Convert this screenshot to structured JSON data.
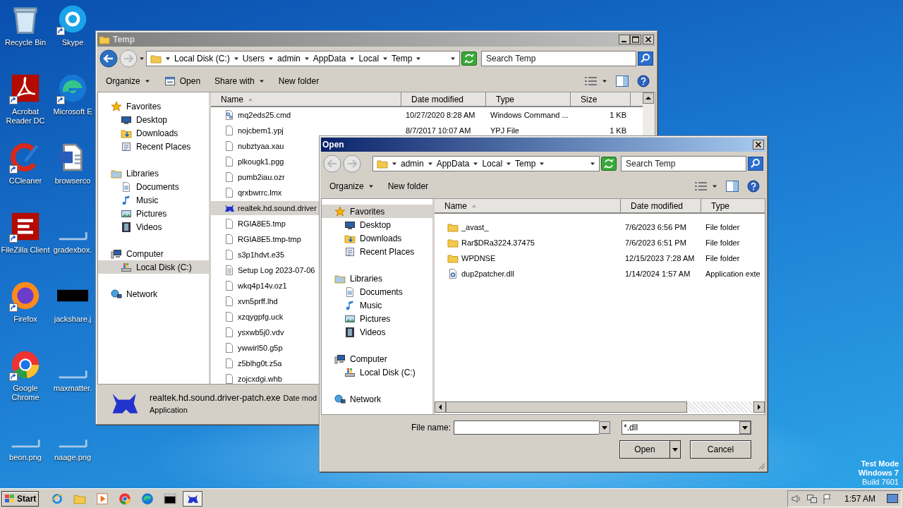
{
  "desktop": {
    "icons": [
      {
        "label": "Recycle Bin",
        "kind": "recycle",
        "shortcut": false
      },
      {
        "label": "Acrobat Reader DC",
        "kind": "acrobat",
        "shortcut": true
      },
      {
        "label": "CCleaner",
        "kind": "ccleaner",
        "shortcut": true
      },
      {
        "label": "FileZilla Client",
        "kind": "filezilla",
        "shortcut": true
      },
      {
        "label": "Firefox",
        "kind": "firefox",
        "shortcut": true
      },
      {
        "label": "Google Chrome",
        "kind": "chrome",
        "shortcut": true
      },
      {
        "label": "beon.png",
        "kind": "blank",
        "shortcut": false
      },
      {
        "label": "Skype",
        "kind": "skype",
        "shortcut": true
      },
      {
        "label": "Microsoft E",
        "kind": "edge",
        "shortcut": true
      },
      {
        "label": "browserco",
        "kind": "word",
        "shortcut": false
      },
      {
        "label": "gradexbox.",
        "kind": "blank",
        "shortcut": false
      },
      {
        "label": "jackshare.j",
        "kind": "dark",
        "shortcut": false
      },
      {
        "label": "maxmatter.",
        "kind": "blank",
        "shortcut": false
      },
      {
        "label": "naage.png",
        "kind": "blank",
        "shortcut": false
      }
    ]
  },
  "explorer": {
    "title": "Temp",
    "breadcrumb": [
      "Local Disk (C:)",
      "Users",
      "admin",
      "AppData",
      "Local",
      "Temp"
    ],
    "search_placeholder": "Search Temp",
    "toolbar": [
      {
        "label": "Organize",
        "kind": "menu"
      },
      {
        "label": "Open",
        "kind": "icon"
      },
      {
        "label": "Share with",
        "kind": "menu"
      },
      {
        "label": "New folder",
        "kind": "plain"
      }
    ],
    "nav": [
      {
        "label": "Favorites",
        "kind": "star",
        "selected": false,
        "children": [
          {
            "label": "Desktop",
            "kind": "desktop",
            "selected": false
          },
          {
            "label": "Downloads",
            "kind": "downloads",
            "selected": false
          },
          {
            "label": "Recent Places",
            "kind": "recent",
            "selected": false
          }
        ]
      },
      {
        "label": "Libraries",
        "kind": "libraries",
        "selected": false,
        "children": [
          {
            "label": "Documents",
            "kind": "documents",
            "selected": false
          },
          {
            "label": "Music",
            "kind": "music",
            "selected": false
          },
          {
            "label": "Pictures",
            "kind": "pictures",
            "selected": false
          },
          {
            "label": "Videos",
            "kind": "videos",
            "selected": false
          }
        ]
      },
      {
        "label": "Computer",
        "kind": "computer",
        "selected": false,
        "children": [
          {
            "label": "Local Disk (C:)",
            "kind": "disk",
            "selected": true
          }
        ]
      },
      {
        "label": "Network",
        "kind": "network",
        "selected": false
      }
    ],
    "columns": [
      "Name",
      "Date modified",
      "Type",
      "Size"
    ],
    "rows": [
      {
        "name": "mq2eds25.cmd",
        "date": "10/27/2020 8:28 AM",
        "type": "Windows Command ...",
        "size": "1 KB",
        "kind": "cmd",
        "selected": false
      },
      {
        "name": "nojcbem1.ypj",
        "date": "8/7/2017 10:07 AM",
        "type": "YPJ File",
        "size": "1 KB",
        "kind": "file",
        "selected": false
      },
      {
        "name": "nubztyaa.xau",
        "kind": "file",
        "selected": false
      },
      {
        "name": "plkougk1.pgg",
        "kind": "file",
        "selected": false
      },
      {
        "name": "pumb2iau.ozr",
        "kind": "file",
        "selected": false
      },
      {
        "name": "qrxbwrrc.lmx",
        "kind": "file",
        "selected": false
      },
      {
        "name": "realtek.hd.sound.driver",
        "kind": "exe",
        "selected": true
      },
      {
        "name": "RGIA8E5.tmp",
        "kind": "file",
        "selected": false
      },
      {
        "name": "RGIA8E5.tmp-tmp",
        "kind": "file",
        "selected": false
      },
      {
        "name": "s3p1hdvt.e35",
        "kind": "file",
        "selected": false
      },
      {
        "name": "Setup Log 2023-07-06",
        "kind": "log",
        "selected": false
      },
      {
        "name": "wkq4p14v.oz1",
        "kind": "file",
        "selected": false
      },
      {
        "name": "xvn5prff.lhd",
        "kind": "file",
        "selected": false
      },
      {
        "name": "xzqygpfg.uck",
        "kind": "file",
        "selected": false
      },
      {
        "name": "ysxwb5j0.vdv",
        "kind": "file",
        "selected": false
      },
      {
        "name": "ywwirl50.g5p",
        "kind": "file",
        "selected": false
      },
      {
        "name": "z5blhg0t.z5a",
        "kind": "file",
        "selected": false
      },
      {
        "name": "zojcxdgi.whb",
        "kind": "file",
        "selected": false
      }
    ],
    "details": {
      "name": "realtek.hd.sound.driver-patch.exe",
      "date_label": "Date mod",
      "type": "Application"
    }
  },
  "dialog": {
    "title": "Open",
    "breadcrumb": [
      "admin",
      "AppData",
      "Local",
      "Temp"
    ],
    "search_placeholder": "Search Temp",
    "toolbar": [
      {
        "label": "Organize",
        "kind": "menu"
      },
      {
        "label": "New folder",
        "kind": "plain"
      }
    ],
    "nav": [
      {
        "label": "Favorites",
        "kind": "star",
        "selected": true,
        "children": [
          {
            "label": "Desktop",
            "kind": "desktop",
            "selected": false
          },
          {
            "label": "Downloads",
            "kind": "downloads",
            "selected": false
          },
          {
            "label": "Recent Places",
            "kind": "recent",
            "selected": false
          }
        ]
      },
      {
        "label": "Libraries",
        "kind": "libraries",
        "selected": false,
        "children": [
          {
            "label": "Documents",
            "kind": "documents",
            "selected": false
          },
          {
            "label": "Music",
            "kind": "music",
            "selected": false
          },
          {
            "label": "Pictures",
            "kind": "pictures",
            "selected": false
          },
          {
            "label": "Videos",
            "kind": "videos",
            "selected": false
          }
        ]
      },
      {
        "label": "Computer",
        "kind": "computer",
        "selected": false,
        "children": [
          {
            "label": "Local Disk (C:)",
            "kind": "disk",
            "selected": false
          }
        ]
      },
      {
        "label": "Network",
        "kind": "network",
        "selected": false
      }
    ],
    "columns": [
      "Name",
      "Date modified",
      "Type"
    ],
    "rows": [
      {
        "name": "_avast_",
        "date": "7/6/2023 6:56 PM",
        "type": "File folder",
        "kind": "folder",
        "selected": false
      },
      {
        "name": "Rar$DRa3224.37475",
        "date": "7/6/2023 6:51 PM",
        "type": "File folder",
        "kind": "folder",
        "selected": false
      },
      {
        "name": "WPDNSE",
        "date": "12/15/2023 7:28 AM",
        "type": "File folder",
        "kind": "folder",
        "selected": false
      },
      {
        "name": "dup2patcher.dll",
        "date": "1/14/2024 1:57 AM",
        "type": "Application exte",
        "kind": "dll",
        "selected": false
      }
    ],
    "file_name_label": "File name:",
    "filter": "*.dll",
    "buttons": [
      {
        "label": "Open",
        "kind": "split"
      },
      {
        "label": "Cancel",
        "kind": "plain"
      }
    ]
  },
  "taskbar": {
    "start": "Start",
    "apps": [
      {
        "kind": "ie",
        "active": false
      },
      {
        "kind": "folder",
        "active": false
      },
      {
        "kind": "media",
        "active": false
      },
      {
        "kind": "chrome",
        "active": false
      },
      {
        "kind": "edge",
        "active": false
      },
      {
        "kind": "terminal",
        "active": false
      },
      {
        "kind": "exe",
        "active": true
      }
    ],
    "clock": "1:57 AM"
  },
  "test_mode_notice": [
    "Test Mode",
    "Windows 7",
    "Build 7601"
  ]
}
